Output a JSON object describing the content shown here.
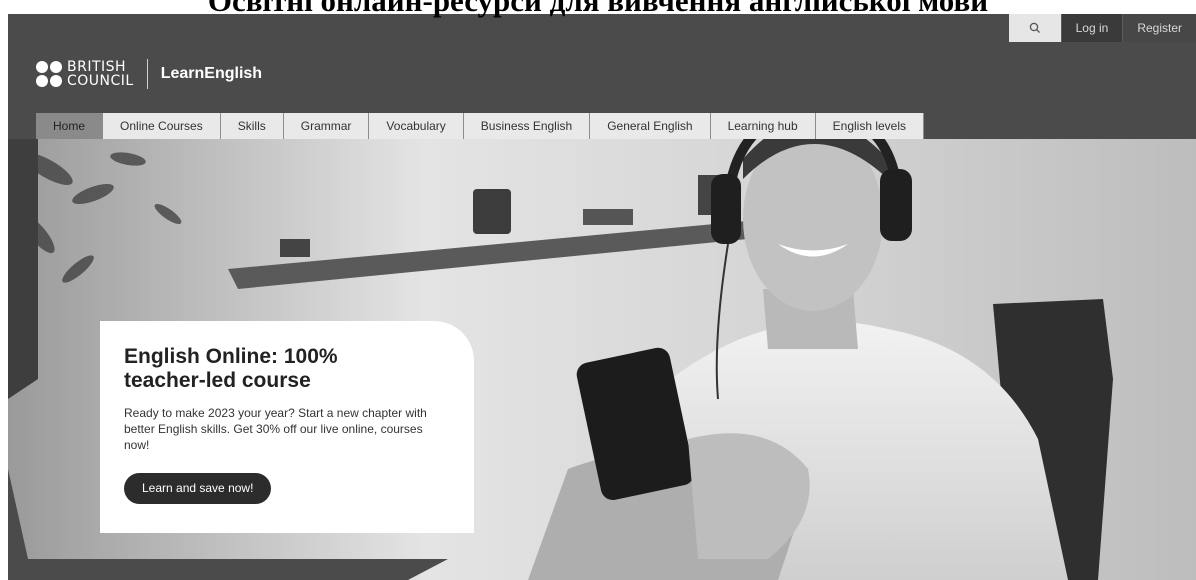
{
  "caption": "Освітні онлайн-ресурси для вивчення англійської мови",
  "utility": {
    "search_icon": "search-icon",
    "login_label": "Log in",
    "register_label": "Register"
  },
  "logo": {
    "line1": "BRITISH",
    "line2": "COUNCIL",
    "product": "LearnEnglish"
  },
  "nav": {
    "items": [
      {
        "label": "Home",
        "active": true
      },
      {
        "label": "Online Courses"
      },
      {
        "label": "Skills"
      },
      {
        "label": "Grammar"
      },
      {
        "label": "Vocabulary"
      },
      {
        "label": "Business English"
      },
      {
        "label": "General English"
      },
      {
        "label": "Learning hub"
      },
      {
        "label": "English levels"
      }
    ]
  },
  "promo": {
    "title": "English Online: 100% teacher-led course",
    "text": "Ready to make 2023 your year? Start a new chapter with better English skills. Get 30% off our live online, courses now!",
    "button_label": "Learn and save now!"
  }
}
